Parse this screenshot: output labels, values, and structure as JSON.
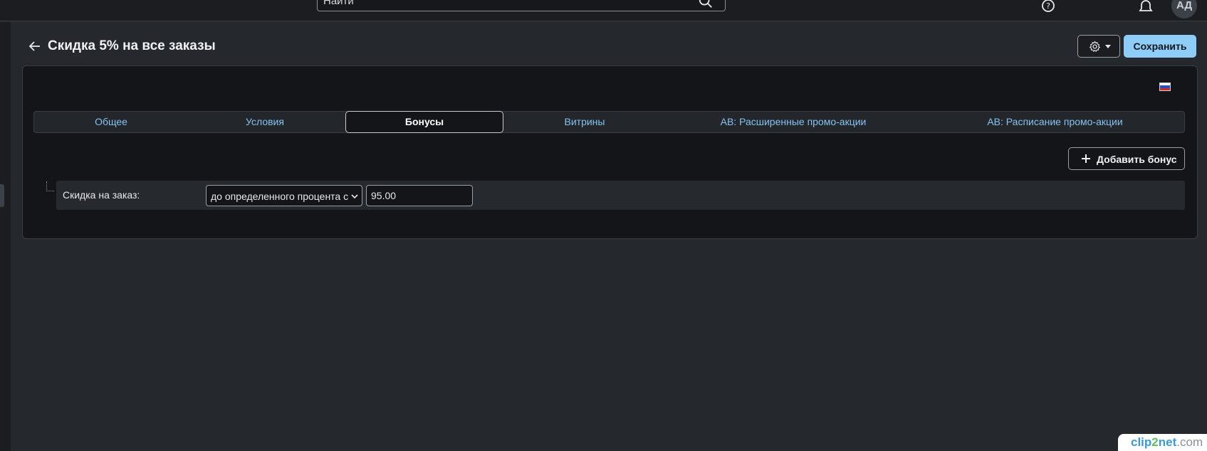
{
  "topbar": {
    "search_placeholder": "Найти",
    "help_icon": "help-circle-icon",
    "bell_icon": "bell-icon",
    "avatar_initials": "АД"
  },
  "header": {
    "title": "Скидка 5% на все заказы",
    "save_label": "Сохранить",
    "gear_icon": "gear-icon"
  },
  "locale": {
    "flag": "ru"
  },
  "tabs": [
    {
      "label": "Общее",
      "active": false
    },
    {
      "label": "Условия",
      "active": false
    },
    {
      "label": "Бонусы",
      "active": true
    },
    {
      "label": "Витрины",
      "active": false
    },
    {
      "label": "АВ: Расширенные промо-акции",
      "active": false
    },
    {
      "label": "АВ: Расписание промо-акции",
      "active": false
    }
  ],
  "bonuses": {
    "add_label": "Добавить бонус",
    "items": [
      {
        "label": "Скидка на заказ:",
        "type_value": "до определенного процента с",
        "amount": "95.00"
      }
    ]
  },
  "watermark": {
    "part1": "clip",
    "part2": "2",
    "part3": "net",
    "part4": ".com"
  },
  "colors": {
    "accent": "#8ecdf7",
    "link": "#86c3f0",
    "background": "#25282d",
    "panel": "#131518"
  }
}
